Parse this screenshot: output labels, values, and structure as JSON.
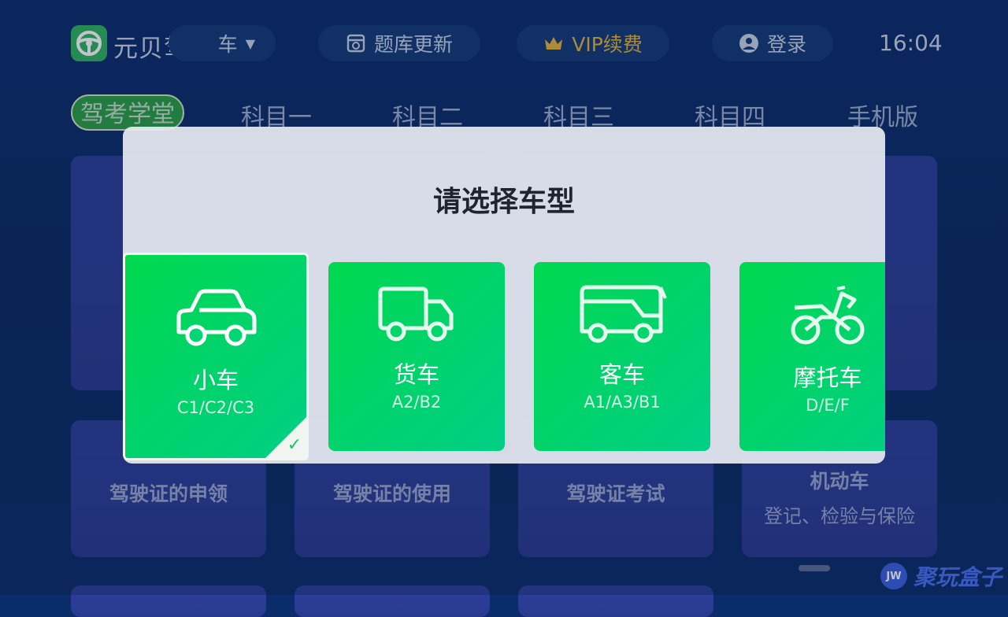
{
  "topbar": {
    "app_name": "元贝驾考",
    "vehicle_type_label": "车",
    "update_label": "题库更新",
    "vip_label": "VIP续费",
    "login_label": "登录",
    "time": "16:04"
  },
  "tabs": [
    {
      "label": "驾考学堂",
      "active": true
    },
    {
      "label": "科目一"
    },
    {
      "label": "科目二"
    },
    {
      "label": "科目三"
    },
    {
      "label": "科目四"
    },
    {
      "label": "手机版"
    }
  ],
  "background_cards": [
    {
      "title": "驾驶证的申领"
    },
    {
      "title": "驾驶证的使用"
    },
    {
      "title": "驾驶证考试"
    },
    {
      "title": "机动车",
      "subtitle": "登记、检验与保险"
    }
  ],
  "modal": {
    "title": "请选择车型",
    "vehicles": [
      {
        "name": "小车",
        "codes": "C1/C2/C3",
        "icon": "car-icon",
        "selected": true
      },
      {
        "name": "货车",
        "codes": "A2/B2",
        "icon": "truck-icon"
      },
      {
        "name": "客车",
        "codes": "A1/A3/B1",
        "icon": "bus-icon"
      },
      {
        "name": "摩托车",
        "codes": "D/E/F",
        "icon": "motorcycle-icon"
      }
    ]
  },
  "watermark": {
    "badge": "JW",
    "text": "聚玩盒子"
  },
  "colors": {
    "accent_green": "#00d84e",
    "vip_gold": "#e7b338",
    "background": "#0a2c6a"
  }
}
